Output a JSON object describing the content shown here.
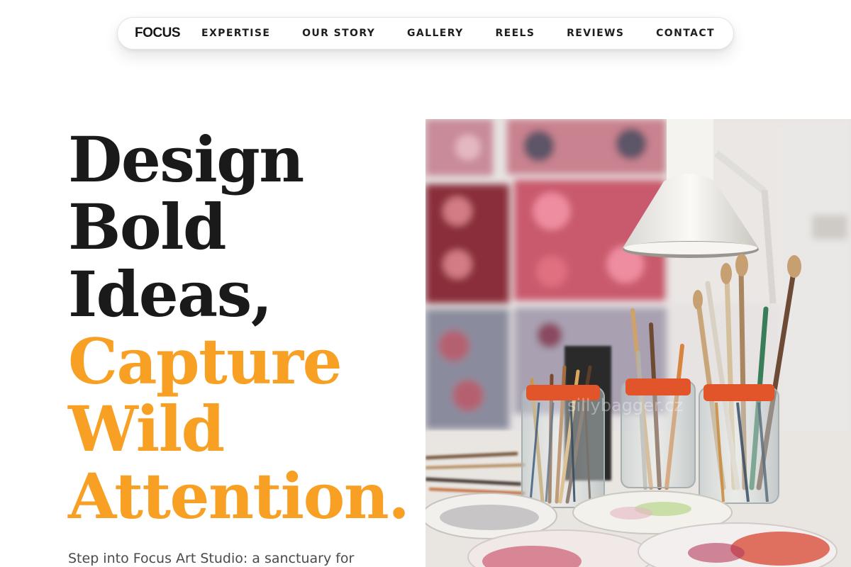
{
  "header": {
    "brand": "FOCUS",
    "nav_items": [
      {
        "label": "EXPERTISE"
      },
      {
        "label": "OUR STORY"
      },
      {
        "label": "GALLERY"
      },
      {
        "label": "REELS"
      },
      {
        "label": "REVIEWS"
      },
      {
        "label": "CONTACT"
      }
    ]
  },
  "hero": {
    "title_lines_dark": [
      "Design",
      "Bold",
      "Ideas,"
    ],
    "title_lines_accent": [
      "Capture",
      "Wild",
      "Attention."
    ],
    "description": "Step into Focus Art Studio: a sanctuary for",
    "accent_color": "#f8a024",
    "image_watermark": "sillybagger.cz"
  }
}
